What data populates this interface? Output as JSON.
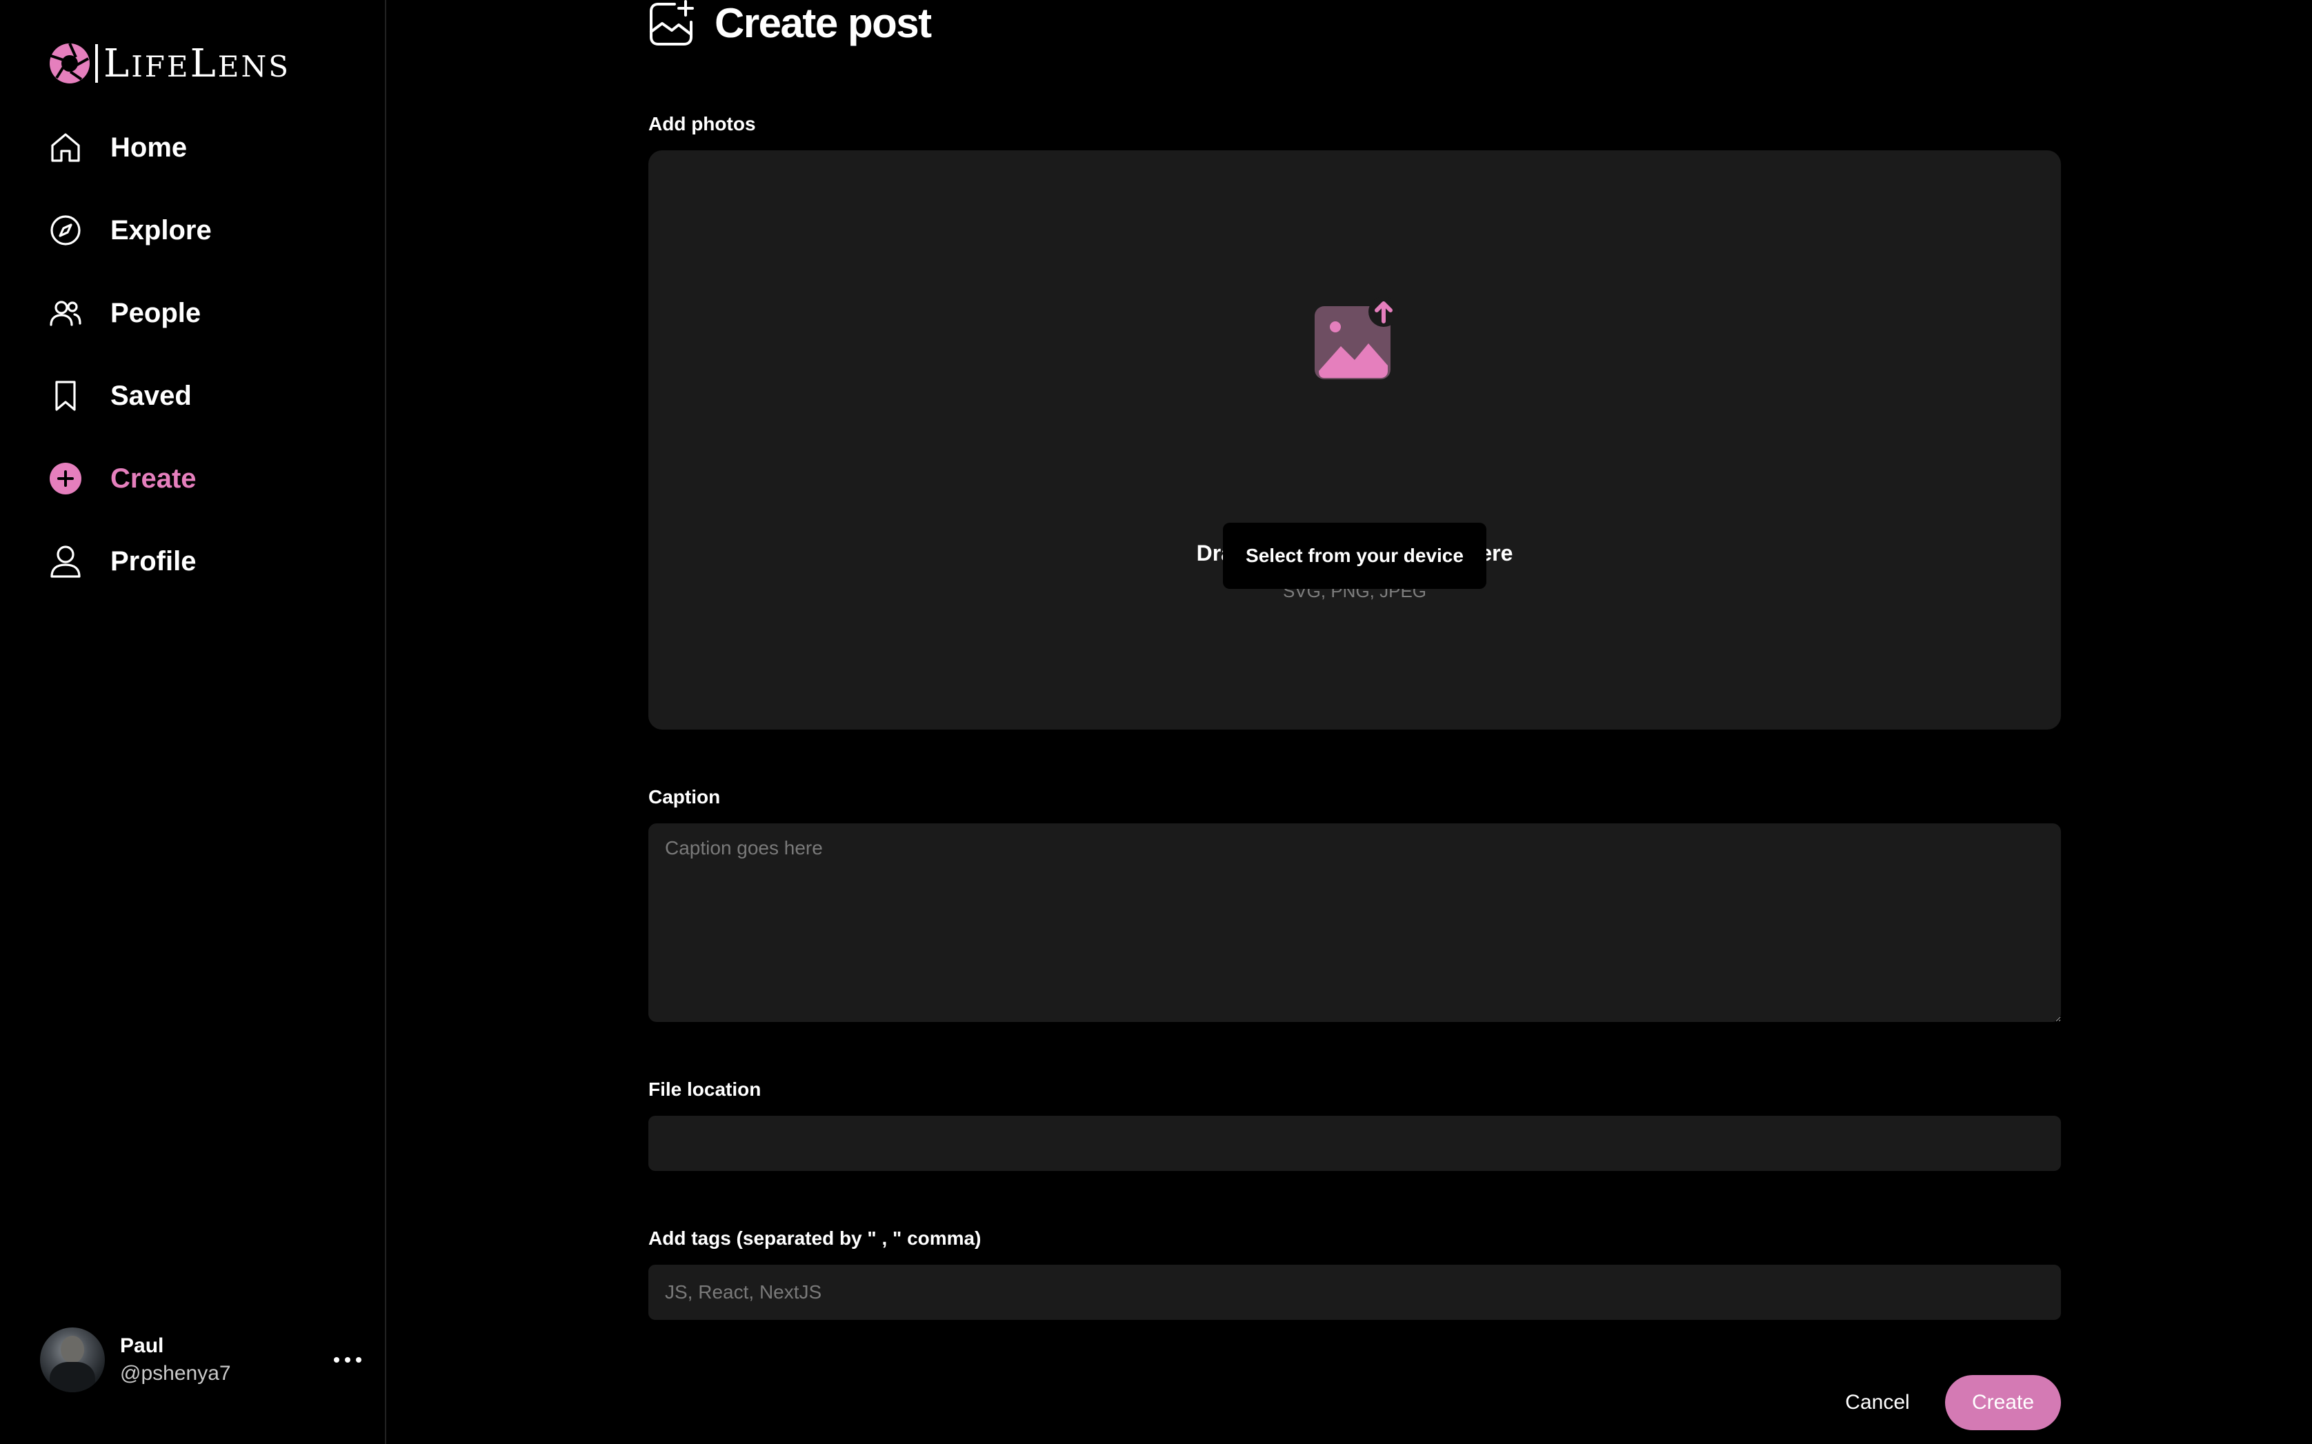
{
  "app": {
    "logo_text_first": "L",
    "logo_text_mid": "IFE",
    "logo_text_cap": "L",
    "logo_text_end": "ENS",
    "accent_color": "#e57fbd"
  },
  "sidebar": {
    "items": [
      {
        "label": "Home",
        "icon": "home-icon"
      },
      {
        "label": "Explore",
        "icon": "compass-icon"
      },
      {
        "label": "People",
        "icon": "people-icon"
      },
      {
        "label": "Saved",
        "icon": "bookmark-icon"
      },
      {
        "label": "Create",
        "icon": "add-circle-icon",
        "active": true
      },
      {
        "label": "Profile",
        "icon": "user-icon"
      }
    ],
    "user": {
      "name": "Paul",
      "handle": "@pshenya7"
    }
  },
  "page": {
    "title": "Create post",
    "icon": "add-image-icon"
  },
  "form": {
    "photos_label": "Add photos",
    "dropzone": {
      "icon": "image-upload-icon",
      "title": "Drag & drop your images here",
      "formats": "SVG, PNG, JPEG",
      "button_label": "Select from your device"
    },
    "caption_label": "Caption",
    "caption_placeholder": "Caption goes here",
    "caption_value": "",
    "location_label": "File location",
    "location_value": "",
    "tags_label": "Add tags (separated by \" , \" comma)",
    "tags_placeholder": "JS, React, NextJS",
    "tags_value": "",
    "cancel_label": "Cancel",
    "create_label": "Create"
  }
}
